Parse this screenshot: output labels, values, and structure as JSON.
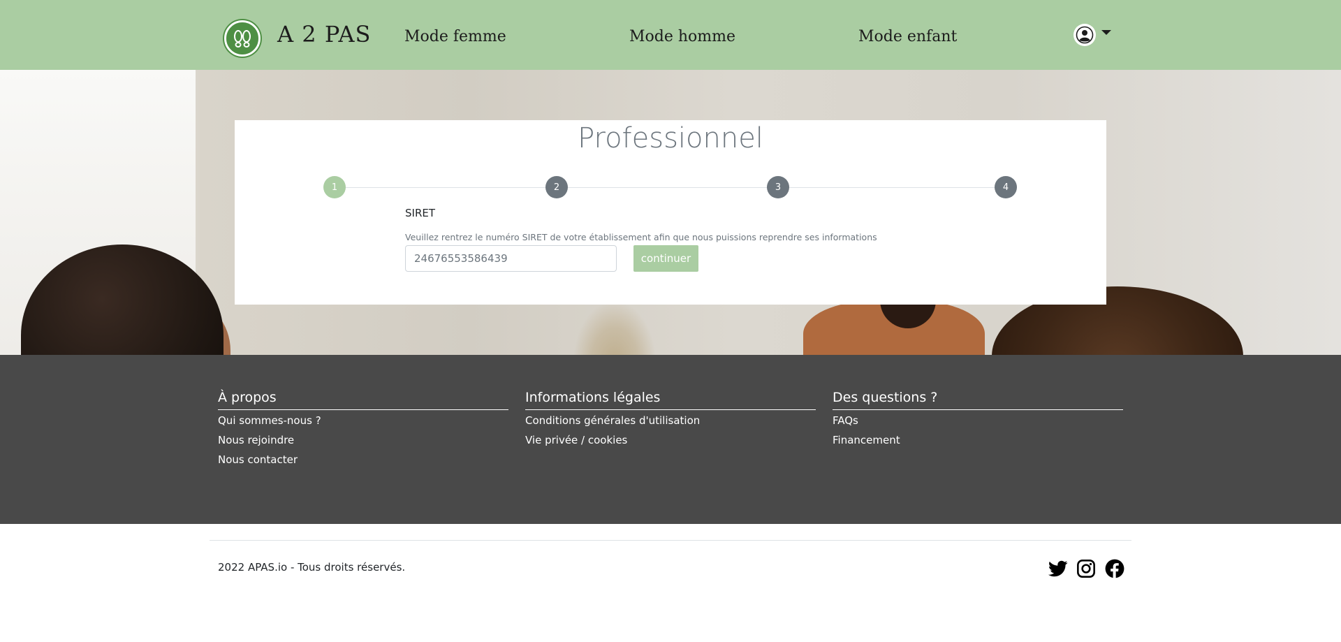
{
  "header": {
    "brand": "A 2 PAS",
    "nav": {
      "femme": "Mode femme",
      "homme": "Mode homme",
      "enfant": "Mode enfant"
    },
    "accent_color": "#aacda2"
  },
  "card": {
    "title": "Professionnel",
    "steps": [
      "1",
      "2",
      "3",
      "4"
    ],
    "active_step": 1,
    "siret_label": "SIRET",
    "siret_help": "Veuillez rentrez le numéro SIRET de votre établissement afin que nous puissions reprendre ses informations",
    "siret_value": "24676553586439",
    "continue_label": "continuer"
  },
  "footer": {
    "about": {
      "title": "À propos",
      "links": [
        "Qui sommes-nous ?",
        "Nous rejoindre",
        "Nous contacter"
      ]
    },
    "legal": {
      "title": "Informations légales",
      "links": [
        "Conditions générales d'utilisation",
        "Vie privée / cookies"
      ]
    },
    "questions": {
      "title": "Des questions ?",
      "links": [
        "FAQs",
        "Financement"
      ]
    },
    "copyright": "2022 APAS.io - Tous droits réservés.",
    "social_icons": [
      "twitter-icon",
      "instagram-icon",
      "facebook-icon"
    ]
  }
}
